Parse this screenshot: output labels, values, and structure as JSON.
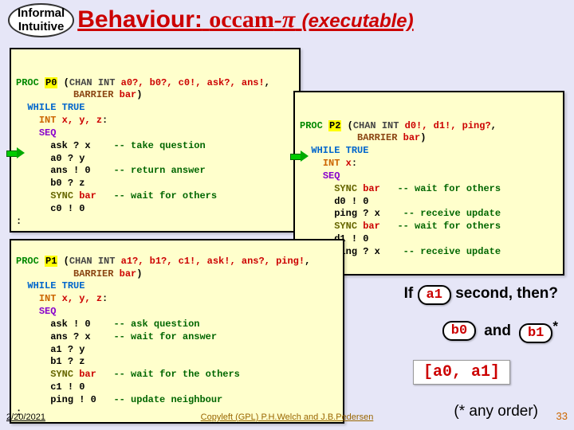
{
  "header": {
    "oval_l1": "Informal",
    "oval_l2": "Intuitive",
    "title_pre": "Behaviour:",
    "occam": "occam",
    "pi": "-π",
    "exec": "(executable)"
  },
  "c": {
    "PROC": "PROC",
    "CHANINT": "CHAN INT",
    "BARRIER": "BARRIER",
    "WHILETRUE": "WHILE TRUE",
    "INT": "INT",
    "SEQ": "SEQ",
    "SYNC": "SYNC",
    "bar": "bar"
  },
  "p0": {
    "name": "P0",
    "params": "a0?, b0?, c0!, ask?, ans!",
    "vars": "x, y, z",
    "l1": "ask ? x",
    "c1": "-- take question",
    "l2": "a0 ? y",
    "l3": "ans ! 0",
    "c3": "-- return answer",
    "l4": "b0 ? z",
    "c5": "-- wait for others",
    "l6": "c0 ! 0"
  },
  "p2": {
    "name": "P2",
    "params": "d0!, d1!, ping?",
    "vars": "x",
    "c1": "-- wait for others",
    "l2": "d0 ! 0",
    "l3": "ping ? x",
    "c3": "-- receive update",
    "c4": "-- wait for others",
    "l5": "d1 ! 0",
    "l6": "ping ? x",
    "c6": "-- receive update"
  },
  "p1": {
    "name": "P1",
    "params": "a1?, b1?, c1!, ask!, ans?, ping!",
    "vars": "x, y, z",
    "l1": "ask ! 0",
    "c1": "-- ask question",
    "l2": "ans ? x",
    "c2": "-- wait for answer",
    "l3": "a1 ? y",
    "l4": "b1 ? z",
    "c5": "-- wait for the others",
    "l6": "c1 ! 0",
    "l7": "ping ! 0",
    "c7": "-- update neighbour"
  },
  "q": {
    "if": "If",
    "chip_a1": "a1",
    "second": "second, then?",
    "chip_b0": "b0",
    "and": "and",
    "chip_b1": "b1",
    "star": "*",
    "list": "[a0, a1]",
    "anyorder": "(* any order)"
  },
  "footer": {
    "date": "2/20/2021",
    "copy": "Copyleft (GPL) P.H.Welch and J.B.Pedersen",
    "page": "33"
  }
}
